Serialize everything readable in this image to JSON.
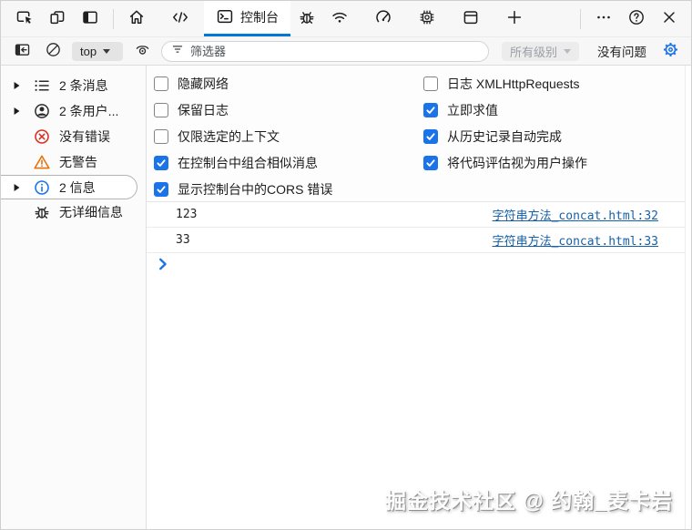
{
  "toolbar_top": {
    "console_tab_label": "控制台"
  },
  "toolbar_console": {
    "context_selector_value": "top",
    "filter_placeholder": "筛选器",
    "levels_dropdown_label": "所有级别",
    "issues_label": "没有问题"
  },
  "sidebar": {
    "items": [
      {
        "label": "2 条消息",
        "icon": "list-icon",
        "expandable": true,
        "selected": false
      },
      {
        "label": "2 条用户...",
        "icon": "user-icon",
        "expandable": true,
        "selected": false
      },
      {
        "label": "没有错误",
        "icon": "error-icon",
        "expandable": false,
        "selected": false
      },
      {
        "label": "无警告",
        "icon": "warning-icon",
        "expandable": false,
        "selected": false
      },
      {
        "label": "2 信息",
        "icon": "info-icon",
        "expandable": true,
        "selected": true
      },
      {
        "label": "无详细信息",
        "icon": "bug-icon",
        "expandable": false,
        "selected": false
      }
    ]
  },
  "settings": {
    "left": [
      {
        "label": "隐藏网络",
        "checked": false
      },
      {
        "label": "保留日志",
        "checked": false
      },
      {
        "label": "仅限选定的上下文",
        "checked": false
      },
      {
        "label": "在控制台中组合相似消息",
        "checked": true
      },
      {
        "label": "显示控制台中的CORS 错误",
        "checked": true
      }
    ],
    "right": [
      {
        "label": "日志 XMLHttpRequests",
        "checked": false
      },
      {
        "label": "立即求值",
        "checked": true
      },
      {
        "label": "从历史记录自动完成",
        "checked": true
      },
      {
        "label": "将代码评估视为用户操作",
        "checked": true
      }
    ]
  },
  "console": {
    "messages": [
      {
        "text": "123",
        "source": "字符串方法_concat.html:32"
      },
      {
        "text": "33",
        "source": "字符串方法_concat.html:33"
      }
    ]
  },
  "watermark": "掘金技术社区 @ 约翰_麦卡岩",
  "colors": {
    "tab_underline": "#0078d4",
    "checkbox_checked": "#1a73e8",
    "link": "#1560a8",
    "error": "#d93025",
    "warning": "#e8710a",
    "info": "#1a73e8",
    "gear": "#1a73e8"
  }
}
